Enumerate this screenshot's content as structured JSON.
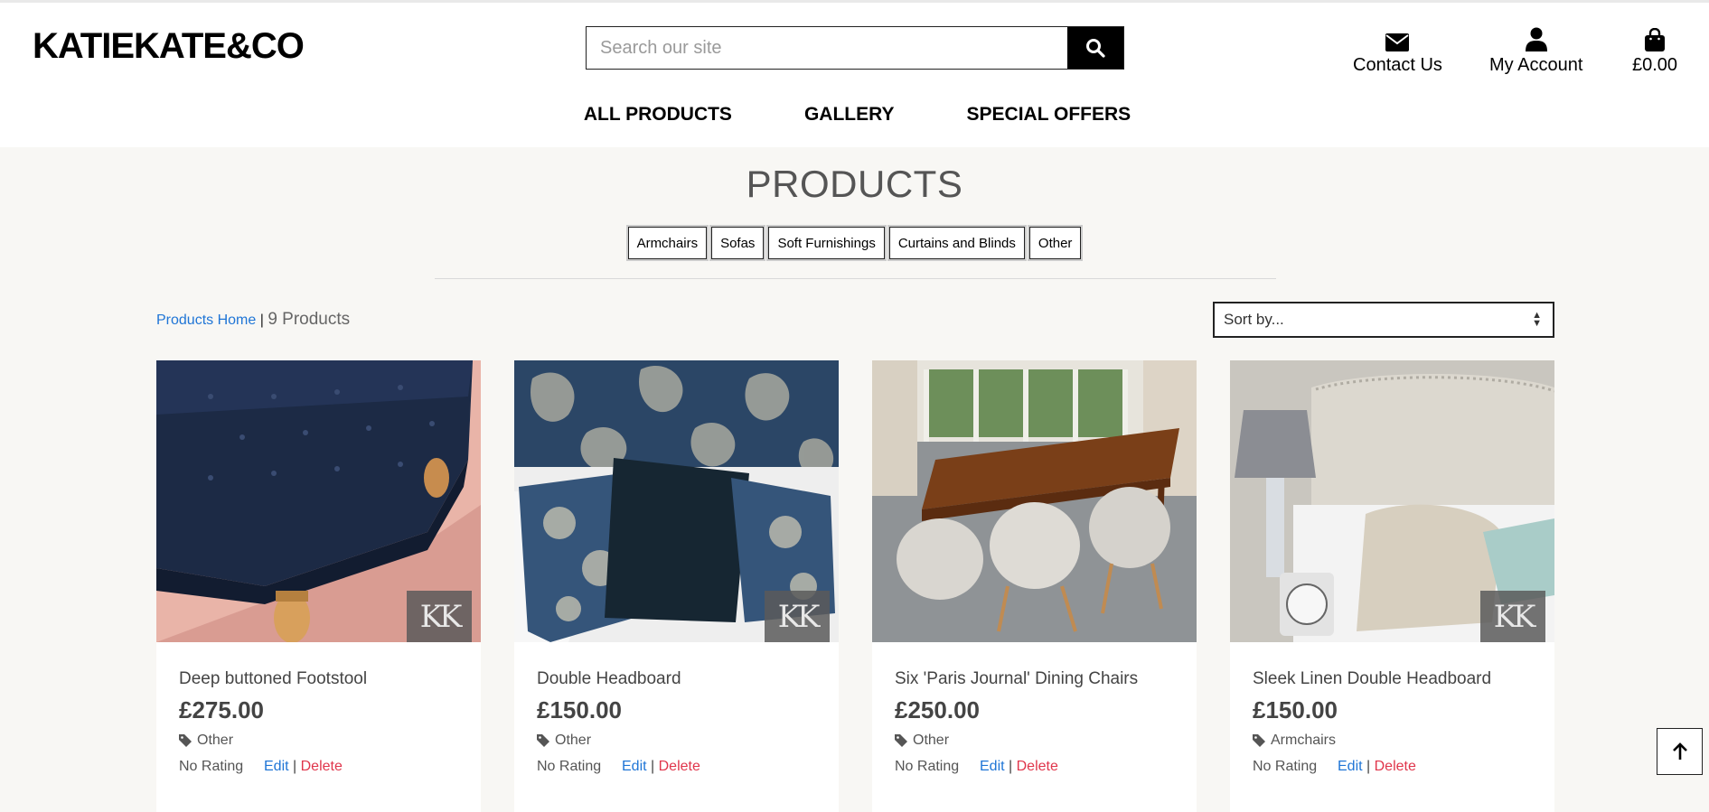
{
  "brand": {
    "logo": "KATIEKATE&CO"
  },
  "search": {
    "placeholder": "Search our site",
    "button_icon": "search-icon"
  },
  "header_links": [
    {
      "label": "Contact Us",
      "icon": "envelope-icon"
    },
    {
      "label": "My Account",
      "icon": "user-icon"
    },
    {
      "label": "£0.00",
      "icon": "shopping-bag-icon"
    }
  ],
  "nav": [
    "ALL PRODUCTS",
    "GALLERY",
    "SPECIAL OFFERS"
  ],
  "page": {
    "title": "PRODUCTS"
  },
  "categories": [
    "Armchairs",
    "Sofas",
    "Soft Furnishings",
    "Curtains and Blinds",
    "Other"
  ],
  "breadcrumb": {
    "link": "Products Home",
    "separator": "|",
    "count": "9 Products"
  },
  "sort": {
    "selected": "Sort by..."
  },
  "products": [
    {
      "name": "Deep buttoned Footstool",
      "price": "£275.00",
      "category": "Other",
      "rating": "No Rating",
      "edit": "Edit",
      "delete": "Delete",
      "watermark": "KK"
    },
    {
      "name": "Double Headboard",
      "price": "£150.00",
      "category": "Other",
      "rating": "No Rating",
      "edit": "Edit",
      "delete": "Delete",
      "watermark": "KK"
    },
    {
      "name": "Six 'Paris Journal' Dining Chairs",
      "price": "£250.00",
      "category": "Other",
      "rating": "No Rating",
      "edit": "Edit",
      "delete": "Delete",
      "watermark": ""
    },
    {
      "name": "Sleek Linen Double Headboard",
      "price": "£150.00",
      "category": "Armchairs",
      "rating": "No Rating",
      "edit": "Edit",
      "delete": "Delete",
      "watermark": "KK"
    }
  ],
  "colors": {
    "link": "#1f75d6",
    "delete": "#e0354b",
    "background": "#f8f7f4"
  },
  "back_to_top": {
    "icon": "arrow-up-icon"
  }
}
